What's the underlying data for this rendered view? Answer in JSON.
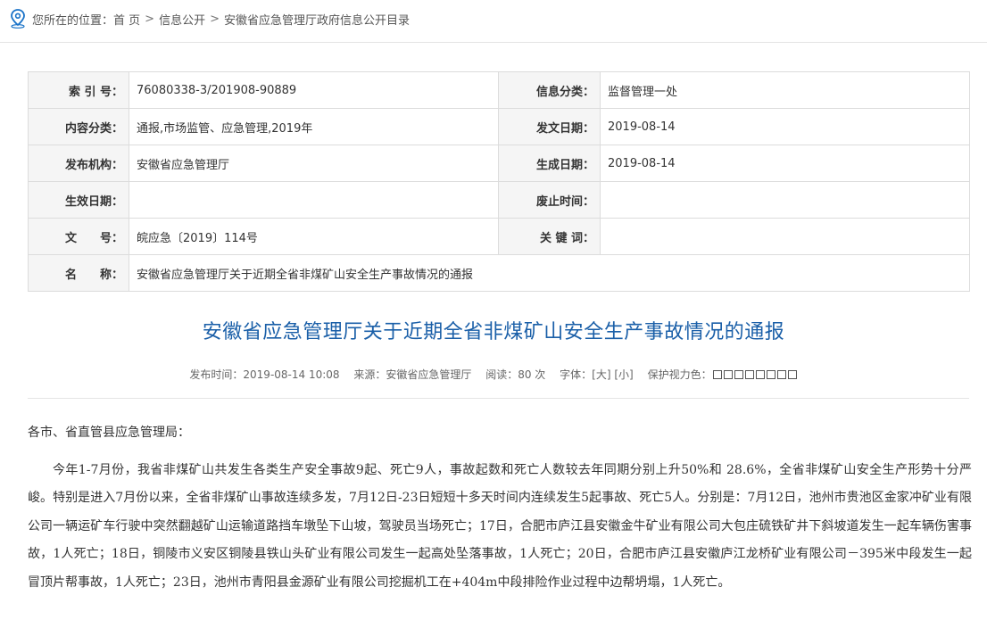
{
  "breadcrumb": {
    "prefix": "您所在的位置：",
    "items": [
      "首 页",
      "信息公开",
      "安徽省应急管理厅政府信息公开目录"
    ],
    "sep": ">"
  },
  "meta": {
    "index_label": "索 引 号：",
    "index_value": "76080338-3/201908-90889",
    "class_label": "信息分类：",
    "class_value": "监督管理一处",
    "content_label": "内容分类：",
    "content_value": "通报,市场监管、应急管理,2019年",
    "issue_label": "发文日期：",
    "issue_value": "2019-08-14",
    "org_label": "发布机构：",
    "org_value": "安徽省应急管理厅",
    "gen_label": "生成日期：",
    "gen_value": "2019-08-14",
    "effective_label": "生效日期：",
    "effective_value": "",
    "abolish_label": "废止时间：",
    "abolish_value": "",
    "docno_label": "文　　号：",
    "docno_value": "皖应急〔2019〕114号",
    "keyword_label": "关 键 词：",
    "keyword_value": "",
    "name_label": "名　　称：",
    "name_value": "安徽省应急管理厅关于近期全省非煤矿山安全生产事故情况的通报"
  },
  "article": {
    "title": "安徽省应急管理厅关于近期全省非煤矿山安全生产事故情况的通报",
    "publish": "发布时间：2019-08-14 10:08",
    "source": "来源：安徽省应急管理厅",
    "views": "阅读：80 次",
    "font_label": "字体：",
    "font_large": "[大]",
    "font_small": "[小]",
    "eye_label": "保护视力色：",
    "salutation": "各市、省直管县应急管理局：",
    "paragraph": "今年1-7月份，我省非煤矿山共发生各类生产安全事故9起、死亡9人，事故起数和死亡人数较去年同期分别上升50%和 28.6%，全省非煤矿山安全生产形势十分严峻。特别是进入7月份以来，全省非煤矿山事故连续多发，7月12日-23日短短十多天时间内连续发生5起事故、死亡5人。分别是：7月12日，池州市贵池区金家冲矿业有限公司一辆运矿车行驶中突然翻越矿山运输道路挡车墩坠下山坡，驾驶员当场死亡；17日，合肥市庐江县安徽金牛矿业有限公司大包庄硫铁矿井下斜坡道发生一起车辆伤害事故，1人死亡；18日，铜陵市义安区铜陵县铁山头矿业有限公司发生一起高处坠落事故，1人死亡；20日，合肥市庐江县安徽庐江龙桥矿业有限公司－395米中段发生一起冒顶片帮事故，1人死亡；23日，池州市青阳县金源矿业有限公司挖掘机工在+404m中段排险作业过程中边帮坍塌，1人死亡。"
  }
}
